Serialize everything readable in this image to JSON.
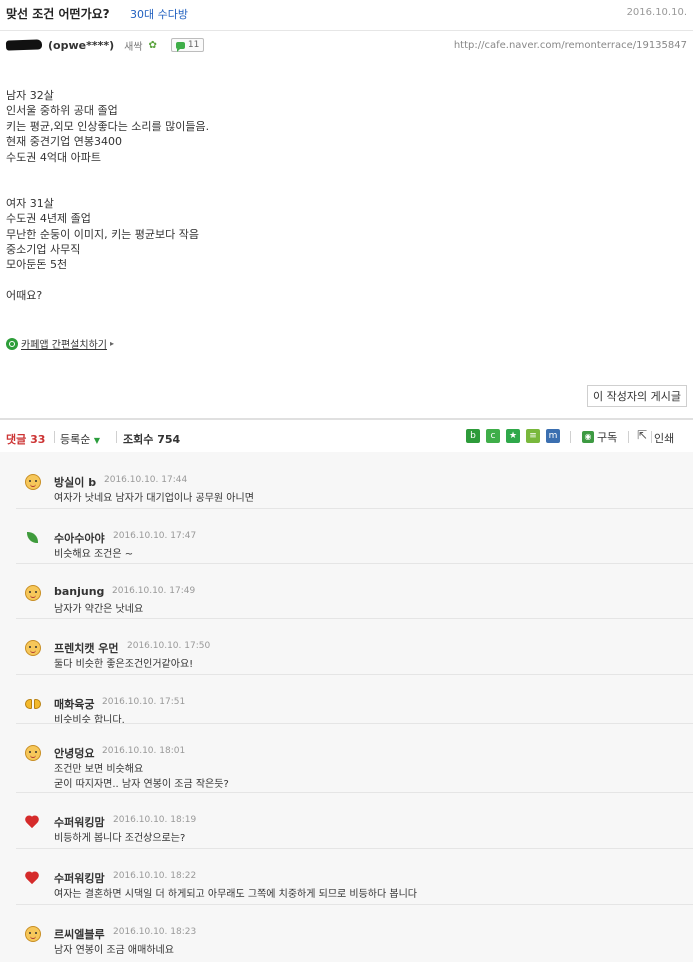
{
  "post": {
    "title": "맞선 조건 어떤가요?",
    "category": "30대 수다방",
    "date": "2016.10.10.",
    "author_id": "(opwe****)",
    "author_level": "새싹",
    "comment_badge": "11",
    "url": "http://cafe.naver.com/remonterrace/19135847",
    "body_lines": [
      "남자 32살",
      "인서울 중하위 공대 졸업",
      "키는 평균,외모 인상좋다는 소리를 많이들음.",
      "현재 중견기업 연봉3400",
      "수도권 4억대 아파트",
      "",
      "",
      "여자 31살",
      "수도권 4년제 졸업",
      "무난한 순둥이 이미지, 키는 평균보다 작음",
      "중소기업 사무직",
      "모아둔돈 5천",
      "",
      "어때요?"
    ],
    "app_install_label": "카페앱 간편설치하기",
    "author_posts_button": "이 작성자의 게시글"
  },
  "toolbar": {
    "comment_label": "댓글",
    "comment_count": "33",
    "sort_label": "등록순",
    "view_label": "조회수",
    "view_count": "754",
    "subscribe_label": "구독",
    "print_label": "인쇄"
  },
  "icons": {
    "share": [
      "blog-icon",
      "cafe-icon",
      "bookmark-star-icon",
      "memo-icon",
      "me2day-icon"
    ],
    "avatars": [
      "smiley-face-icon",
      "leaf-icon",
      "bow-icon",
      "heart-icon"
    ]
  },
  "colors": {
    "category_link": "#1f5fbf",
    "comment_count": "#cc3333",
    "naver_green": "#3fae49"
  },
  "comments": [
    {
      "name": "방실이 b",
      "time": "2016.10.10. 17:44",
      "avatar": "face",
      "lines": [
        "여자가 낫네요 남자가 대기업이나 공무원 아니면"
      ]
    },
    {
      "name": "수아수아야",
      "time": "2016.10.10. 17:47",
      "avatar": "leaf",
      "lines": [
        "비슷해요 조건은 ~"
      ]
    },
    {
      "name": "banjung",
      "time": "2016.10.10. 17:49",
      "avatar": "face",
      "lines": [
        "남자가 약간은 낫네요"
      ]
    },
    {
      "name": "프렌치캣 우먼",
      "time": "2016.10.10. 17:50",
      "avatar": "face",
      "lines": [
        "둘다 비슷한 좋은조건인거같아요!"
      ]
    },
    {
      "name": "매화육궁",
      "time": "2016.10.10. 17:51",
      "avatar": "bow",
      "lines": [
        "비슷비슷 합니다."
      ]
    },
    {
      "name": "안녕덩요",
      "time": "2016.10.10. 18:01",
      "avatar": "face",
      "lines": [
        "조건만 보면 비슷해요",
        "굳이 따지자면.. 남자 연봉이 조금 작은듯?"
      ]
    },
    {
      "name": "수퍼워킹맘",
      "time": "2016.10.10. 18:19",
      "avatar": "heart",
      "lines": [
        "비등하게 봅니다 조건상으로는?"
      ]
    },
    {
      "name": "수퍼워킹맘",
      "time": "2016.10.10. 18:22",
      "avatar": "heart",
      "lines": [
        "여자는 결혼하면 시댁일 더 하게되고 아무래도 그쪽에 치중하게 되므로 비등하다 봅니다"
      ]
    },
    {
      "name": "르씨엘블루",
      "time": "2016.10.10. 18:23",
      "avatar": "face",
      "lines": [
        "남자 연봉이 조금 애매하네요"
      ]
    }
  ]
}
